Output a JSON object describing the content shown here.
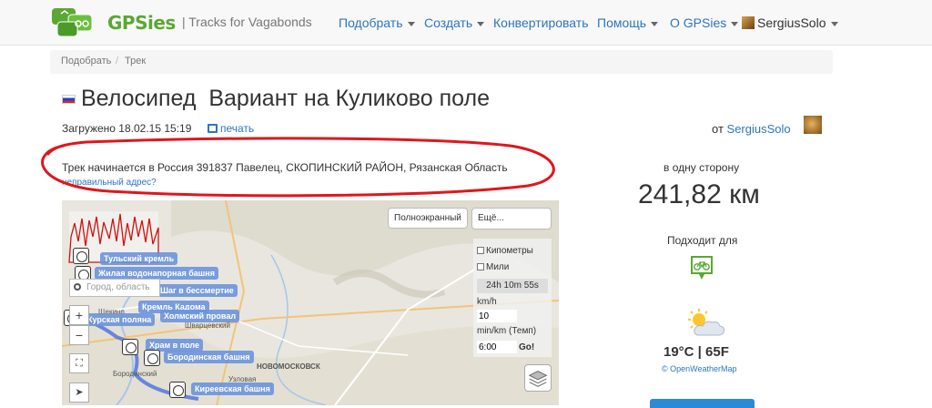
{
  "brand": {
    "name": "GPSies",
    "tagline": "| Tracks for Vagabonds"
  },
  "nav": {
    "items": [
      "Подобрать",
      "Создать",
      "Конвертировать",
      "Помощь",
      "О GPSies"
    ],
    "user": "SergiusSolo"
  },
  "breadcrumb": [
    "Подобрать",
    "Трек"
  ],
  "track": {
    "title": "Велосипед  Вариант на Куликово поле",
    "uploaded": "Загружено 18.02.15 15:19",
    "print": "печать",
    "author_prefix": "от",
    "author": "SergiusSolo",
    "address": "Трек начинается в Россия 391837 Павелец, СКОПИНСКИЙ РАЙОН, Рязанская Область",
    "wrong_address": "неправильный адрес?"
  },
  "map": {
    "fullscreen": "Полноэкранный",
    "more": "Ещё...",
    "search_placeholder": "Город, область",
    "options": {
      "km": "Кипометры",
      "miles": "Мили",
      "time": "24h 10m 55s",
      "speed_unit": "km/h",
      "speed": "10",
      "pace_unit": "min/km (Темп)",
      "pace": "6:00",
      "go": "Go!"
    },
    "pois": [
      "Тульский кремль",
      "Жилая водонапорная башня",
      "Шаг в бессмертие",
      "Кремль Кадома",
      "Курская поляна",
      "Холмский провал",
      "Храм в поле",
      "Бородинская башня",
      "Киреевская башня"
    ],
    "towns": [
      "Щекино",
      "Шварцевский",
      "НОВОМОСКОВСК",
      "Узловая",
      "Бородинский"
    ]
  },
  "stats": {
    "direction": "в одну сторону",
    "distance": "241,82 км",
    "suitable_for": "Подходит для",
    "activity_icon": "bicycle-icon",
    "temperature": "19°C | 65F",
    "weather_source": "© OpenWeatherMap",
    "weather_icon": "partly-cloudy-icon"
  },
  "colors": {
    "brand_green": "#5aa832",
    "link_blue": "#2c76bd",
    "annotation_red": "#e0161c",
    "route_blue": "#4a6ee0"
  }
}
